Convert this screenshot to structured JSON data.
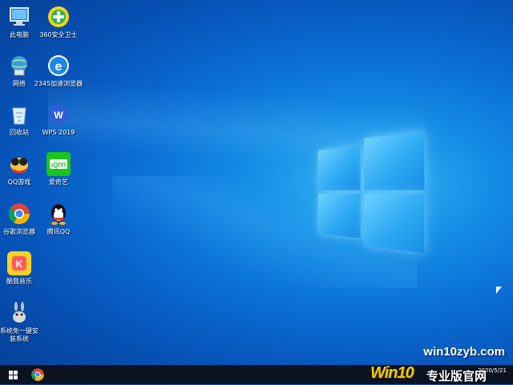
{
  "desktop": {
    "icons": [
      {
        "label": "此电脑",
        "icon": "computer-icon"
      },
      {
        "label": "360安全卫士",
        "icon": "360-security-icon"
      },
      {
        "label": "网络",
        "icon": "network-icon"
      },
      {
        "label": "2345加速浏览器",
        "icon": "2345-browser-icon"
      },
      {
        "label": "回收站",
        "icon": "recycle-bin-icon"
      },
      {
        "label": "WPS 2019",
        "icon": "wps-icon"
      },
      {
        "label": "QQ游戏",
        "icon": "qq-game-icon"
      },
      {
        "label": "爱奇艺",
        "icon": "iqiyi-icon"
      },
      {
        "label": "谷歌浏览器",
        "icon": "chrome-icon"
      },
      {
        "label": "腾讯QQ",
        "icon": "qq-icon"
      },
      {
        "label": "酷我音乐",
        "icon": "kuwo-music-icon"
      },
      {
        "label": "系统免一键安装系统",
        "icon": "system-installer-icon"
      }
    ],
    "watermark": "win10zyb.com"
  },
  "taskbar": {
    "start_icon": "windows-start-icon",
    "pinned_app": "chrome-icon",
    "tray_brand": "Win10专业版官网",
    "tray_brand_prefix": "Win10",
    "tray_brand_suffix": "专业版官网",
    "clock_date": "2020/5/21"
  },
  "colors": {
    "desktop_accent": "#0a6fd6",
    "taskbar_bg": "#0b1220",
    "brand_yellow": "#f7c600"
  }
}
